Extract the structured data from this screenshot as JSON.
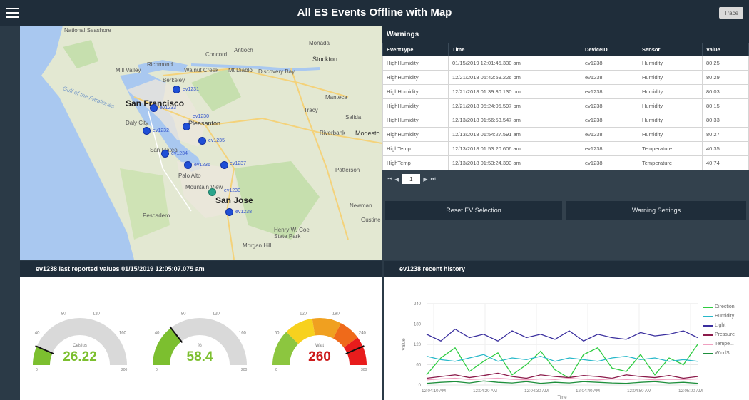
{
  "header": {
    "title": "All ES Events Offline with Map",
    "trace_label": "Trace"
  },
  "map": {
    "labels": {
      "national_seashore": "National Seashore",
      "concord": "Concord",
      "antioch": "Antioch",
      "stockton": "Stockton",
      "richmond": "Richmond",
      "walnut_creek": "Walnut Creek",
      "mt_diablo": "Mt Diablo",
      "discovery_bay": "Discovery Bay",
      "berkeley": "Berkeley",
      "mill_valley": "Mill Valley",
      "san_francisco": "San Francisco",
      "gulf": "Gulf of the Farallones",
      "manteca": "Manteca",
      "tracy": "Tracy",
      "salida": "Salida",
      "daly_city": "Daly City",
      "pleasanton": "Pleasanton",
      "modesto": "Modesto",
      "riverbank": "Riverbank",
      "san_mateo": "San Mateo",
      "palo_alto": "Palo Alto",
      "mountain_view": "Mountain View",
      "san_jose": "San Jose",
      "patterson": "Patterson",
      "newman": "Newman",
      "pescadero": "Pescadero",
      "henry_coe": "Henry W. Coe State Park",
      "gustine": "Gustine",
      "morgan_hill": "Morgan Hill",
      "monada": "Monada"
    },
    "markers": [
      "ev1231",
      "ev1233",
      "ev1232",
      "ev1230",
      "ev1235",
      "ev1234",
      "ev1236",
      "ev1237",
      "ev1230",
      "ev1238"
    ]
  },
  "warnings": {
    "title": "Warnings",
    "columns": [
      "EventType",
      "Time",
      "DeviceID",
      "Sensor",
      "Value"
    ],
    "rows": [
      [
        "HighHumidity",
        "01/15/2019 12:01:45.330 am",
        "ev1238",
        "Humidity",
        "80.25"
      ],
      [
        "HighHumidity",
        "12/21/2018 05:42:59.226 pm",
        "ev1238",
        "Humidity",
        "80.29"
      ],
      [
        "HighHumidity",
        "12/21/2018 01:39:30.130 pm",
        "ev1238",
        "Humidity",
        "80.03"
      ],
      [
        "HighHumidity",
        "12/21/2018 05:24:05.597 pm",
        "ev1238",
        "Humidity",
        "80.15"
      ],
      [
        "HighHumidity",
        "12/13/2018 01:56:53.547 am",
        "ev1238",
        "Humidity",
        "80.33"
      ],
      [
        "HighHumidity",
        "12/13/2018 01:54:27.591 am",
        "ev1238",
        "Humidity",
        "80.27"
      ],
      [
        "HighTemp",
        "12/13/2018 01:53:20.606 am",
        "ev1238",
        "Temperature",
        "40.35"
      ],
      [
        "HighTemp",
        "12/13/2018 01:53:24.393 am",
        "ev1238",
        "Temperature",
        "40.74"
      ]
    ],
    "page": "1",
    "reset_label": "Reset EV Selection",
    "settings_label": "Warning Settings"
  },
  "gauges_panel": {
    "title": "ev1238 last reported values 01/15/2019 12:05:07.075 am",
    "gauges": [
      {
        "value": "26.22",
        "unit": "Celsius",
        "level": 0.13,
        "color": "#7cbf2f",
        "max_label": "200",
        "min_label": "0",
        "ticks": [
          "40",
          "80",
          "120",
          "160"
        ]
      },
      {
        "value": "58.4",
        "unit": "%",
        "level": 0.29,
        "color": "#7cbf2f",
        "max_label": "200",
        "min_label": "0",
        "ticks": [
          "40",
          "80",
          "120",
          "160"
        ]
      },
      {
        "value": "260",
        "unit": "Watt",
        "level": 0.87,
        "color": "#cc1b1b",
        "max_label": "300",
        "min_label": "0",
        "ticks": [
          "60",
          "120",
          "180",
          "240"
        ]
      }
    ]
  },
  "history_panel": {
    "title": "ev1238 recent history",
    "chart_data": {
      "type": "line",
      "xlabel": "Time",
      "ylabel": "Value",
      "ylim": [
        0,
        240
      ],
      "yticks": [
        "0",
        "60",
        "120",
        "180",
        "240"
      ],
      "x": [
        "12:04:10 AM",
        "12:04:20 AM",
        "12:04:30 AM",
        "12:04:40 AM",
        "12:04:50 AM",
        "12:05:00 AM"
      ],
      "series": [
        {
          "name": "Direction",
          "color": "#2ecc40",
          "values": [
            30,
            80,
            110,
            40,
            70,
            95,
            30,
            60,
            100,
            45,
            20,
            90,
            110,
            50,
            40,
            90,
            30,
            80,
            60,
            120
          ]
        },
        {
          "name": "Humidity",
          "color": "#27b8c9",
          "values": [
            85,
            75,
            70,
            80,
            90,
            70,
            80,
            75,
            85,
            70,
            80,
            75,
            70,
            80,
            85,
            75,
            80,
            70,
            75,
            70
          ]
        },
        {
          "name": "Light",
          "color": "#3a2f9e",
          "values": [
            150,
            130,
            165,
            140,
            150,
            130,
            160,
            140,
            150,
            135,
            160,
            130,
            150,
            140,
            135,
            155,
            145,
            150,
            160,
            140
          ]
        },
        {
          "name": "Pressure",
          "color": "#8b1a4a",
          "values": [
            20,
            25,
            30,
            22,
            28,
            35,
            25,
            20,
            30,
            25,
            22,
            28,
            25,
            20,
            30,
            25,
            22,
            28,
            20,
            25
          ]
        },
        {
          "name": "Tempe...",
          "color": "#f0a0c0",
          "values": [
            15,
            18,
            20,
            16,
            18,
            20,
            17,
            15,
            18,
            16,
            20,
            17,
            15,
            18,
            16,
            18,
            15,
            17,
            16,
            18
          ]
        },
        {
          "name": "WindS...",
          "color": "#1e8f3c",
          "values": [
            5,
            8,
            10,
            6,
            12,
            8,
            6,
            10,
            5,
            8,
            6,
            10,
            8,
            6,
            5,
            8,
            10,
            6,
            8,
            5
          ]
        }
      ]
    }
  }
}
